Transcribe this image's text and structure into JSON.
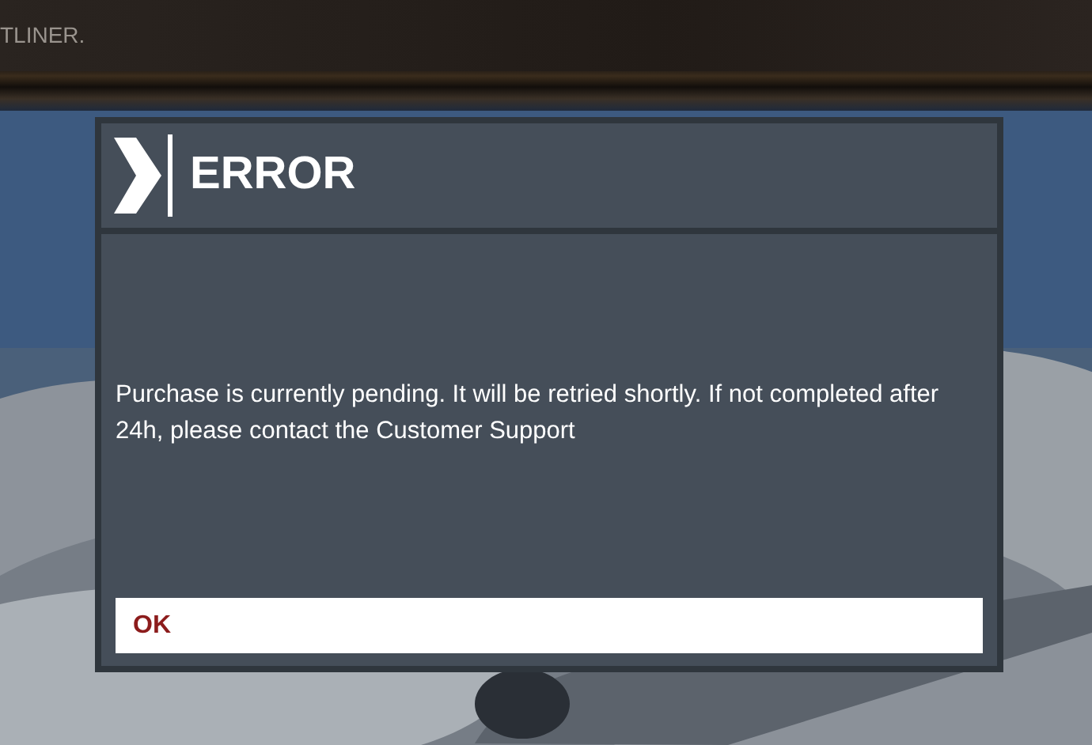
{
  "top_bar": {
    "title": "TLINER."
  },
  "dialog": {
    "title": "ERROR",
    "message": "Purchase is currently pending. It will be retried shortly. If not completed after 24h, please contact the Customer Support",
    "buttons": [
      {
        "label": "OK",
        "selected": true
      }
    ]
  }
}
